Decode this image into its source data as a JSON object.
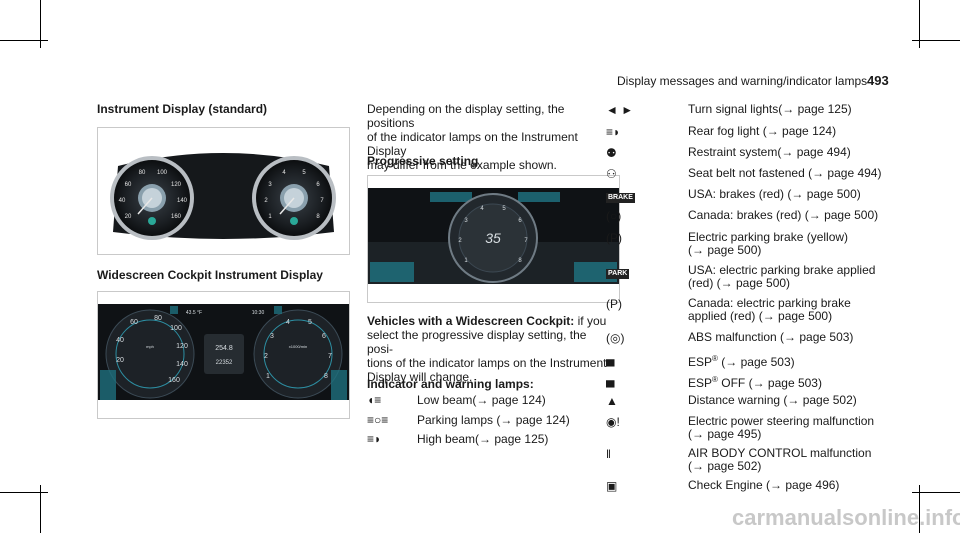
{
  "header": {
    "title": "Display messages and warning/indicator lamps",
    "page_number": "493"
  },
  "left": {
    "heading1": "Instrument Display (standard)",
    "heading2": "Widescreen Cockpit Instrument Display",
    "figure1": {
      "left_dial_ticks": [
        "20",
        "40",
        "60",
        "80",
        "100",
        "120",
        "140",
        "160"
      ],
      "right_dial_ticks": [
        "1",
        "2",
        "3",
        "4",
        "5",
        "6",
        "7",
        "8"
      ]
    },
    "figure2": {
      "top_left_readout": "43.5 °F",
      "top_right_readout": "10:30",
      "left_dial_ticks": [
        "20",
        "40",
        "60",
        "80",
        "100",
        "120",
        "140",
        "160"
      ],
      "left_dial_unit": "mph",
      "right_dial_ticks": [
        "1",
        "2",
        "3",
        "4",
        "5",
        "6",
        "7",
        "8"
      ],
      "right_dial_unit": "x1000/min",
      "center_value1": "254.8",
      "center_value2": "22352"
    }
  },
  "middle": {
    "intro": [
      "Depending on the display setting, the positions",
      "of the indicator lamps on the Instrument Display",
      "may differ from the example shown."
    ],
    "heading_progressive": "Progressive setting",
    "figure3": {
      "speed": "35",
      "ticks": [
        "1",
        "2",
        "3",
        "4",
        "5",
        "6",
        "7",
        "8"
      ]
    },
    "vehicles_bold": "Vehicles with a Widescreen Cockpit:",
    "vehicles_text": [
      " if you",
      "select the progressive display setting, the posi-",
      "tions of the indicator lamps on the Instrument",
      "Display will change."
    ],
    "heading_lamps": "Indicator and warning lamps:",
    "lamps": [
      {
        "icon": "low-beam-icon",
        "label": "Low beam(",
        "page": " page 124)"
      },
      {
        "icon": "parking-lamps-icon",
        "label": "Parking lamps (",
        "page": " page 124)"
      },
      {
        "icon": "high-beam-icon",
        "label": "High beam(",
        "page": " page 125)"
      }
    ]
  },
  "right": {
    "arrow_glyph": "→",
    "lamps": [
      {
        "icon": "turn-signal-icon",
        "lines": [
          "Turn signal lights(",
          " page 125)"
        ]
      },
      {
        "icon": "rear-fog-light-icon",
        "lines": [
          "Rear fog light (",
          " page 124)"
        ]
      },
      {
        "icon": "restraint-system-icon",
        "lines": [
          "Restraint system(",
          " page 494)"
        ]
      },
      {
        "icon": "seat-belt-icon",
        "lines": [
          "Seat belt not fastened (",
          " page 494)"
        ]
      },
      {
        "icon": "brake-icon",
        "badge": "BRAKE",
        "lines": [
          "USA: brakes (red) (",
          " page 500)"
        ]
      },
      {
        "icon": "brake-canada-icon",
        "lines": [
          "Canada: brakes (red) (",
          " page 500)"
        ]
      },
      {
        "icon": "electric-parking-brake-icon",
        "lines": [
          "Electric parking brake (yellow)",
          "(",
          " page 500)"
        ]
      },
      {
        "icon": "park-icon",
        "badge": "PARK",
        "lines": [
          "USA: electric parking brake applied",
          "(red) (",
          " page 500)"
        ]
      },
      {
        "icon": "electric-parking-brake-canada-icon",
        "lines": [
          "Canada: electric parking brake",
          "applied (red) (",
          " page 500)"
        ]
      },
      {
        "icon": "abs-icon",
        "lines": [
          "ABS malfunction (",
          " page 503)"
        ]
      },
      {
        "icon": "esp-icon",
        "lines": [
          "ESP",
          " (",
          " page 503)"
        ]
      },
      {
        "icon": "esp-off-icon",
        "lines": [
          "ESP",
          " OFF (",
          " page 503)"
        ]
      },
      {
        "icon": "distance-warning-icon",
        "lines": [
          "Distance warning (",
          " page 502)"
        ]
      },
      {
        "icon": "power-steering-icon",
        "lines": [
          "Electric power steering malfunction",
          "(",
          " page 495)"
        ]
      },
      {
        "icon": "air-body-control-icon",
        "lines": [
          "AIR BODY CONTROL malfunction",
          "(",
          " page 502)"
        ]
      },
      {
        "icon": "check-engine-icon",
        "lines": [
          "Check Engine (",
          " page 496)"
        ]
      }
    ],
    "registered": "®"
  },
  "watermark": "carmanualsonline.info"
}
